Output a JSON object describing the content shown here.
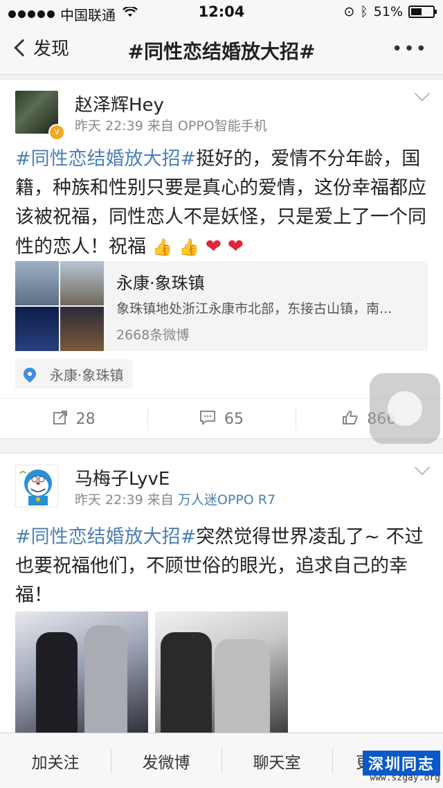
{
  "status_bar": {
    "carrier": "中国联通",
    "time": "12:04",
    "battery": "51%",
    "battery_level": 0.51
  },
  "nav": {
    "back_label": "发现",
    "title": "#同性恋结婚放大招#",
    "more": "•••"
  },
  "posts": [
    {
      "username": "赵泽辉Hey",
      "time": "昨天 22:39",
      "source_prefix": "来自",
      "source": "OPPO智能手机",
      "hashtag": "#同性恋结婚放大招#",
      "text": "挺好的，爱情不分年龄，国籍，种族和性别只要是真心的爱情，这份幸福都应该被祝福，同性恋人不是妖怪，只是爱上了一个同性的恋人！祝福",
      "emojis": [
        "👍",
        "👍",
        "❤",
        "❤"
      ],
      "location_card": {
        "name": "永康·象珠镇",
        "description": "象珠镇地处浙江永康市北部，东接古山镇，南...",
        "count": "2668条微博"
      },
      "location_tag": "永康·象珠镇",
      "actions": {
        "repost": "28",
        "comment": "65",
        "like": "866"
      }
    },
    {
      "username": "马梅子LyvE",
      "time": "昨天 22:39",
      "source_prefix": "来自",
      "source": "万人迷OPPO R7",
      "hashtag": "#同性恋结婚放大招#",
      "text": "突然觉得世界凌乱了~ 不过也要祝福他们，不顾世俗的眼光，追求自己的幸福！"
    }
  ],
  "bottom_bar": {
    "tabs": [
      "加关注",
      "发微博",
      "聊天室",
      "更多内容"
    ]
  },
  "watermark": {
    "main": "深圳同志",
    "url": "www.szgay.org"
  },
  "icons": {
    "repost": "repost-icon",
    "comment": "comment-icon",
    "like": "like-icon",
    "location": "location-pin-icon"
  }
}
